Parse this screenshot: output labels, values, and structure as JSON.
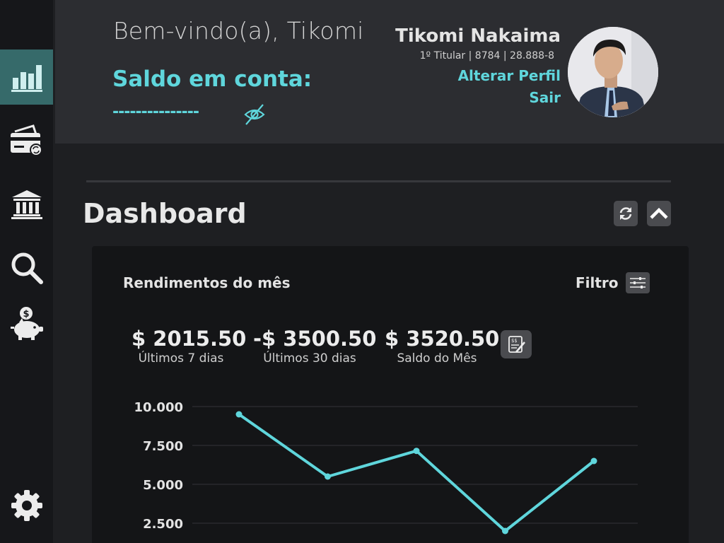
{
  "header": {
    "welcome": "Bem-vindo(a), Tikomi",
    "balance_label": "Saldo em conta:",
    "balance_hidden": "---------------",
    "balance_toggle_icon": "eye-slash-icon",
    "user": {
      "name": "Tikomi Nakaima",
      "info": "1º Titular | 8784 | 28.888-8",
      "edit_profile": "Alterar Perfil",
      "logout": "Sair"
    }
  },
  "sidebar": {
    "items": [
      {
        "icon": "bar-chart-icon",
        "active": true
      },
      {
        "icon": "card-sync-icon",
        "active": false
      },
      {
        "icon": "bank-icon",
        "active": false
      },
      {
        "icon": "search-icon",
        "active": false
      },
      {
        "icon": "piggy-bank-icon",
        "active": false
      },
      {
        "icon": "gear-icon",
        "active": false
      }
    ]
  },
  "dashboard": {
    "title": "Dashboard",
    "refresh_icon": "refresh-icon",
    "collapse_icon": "chevron-up-icon",
    "card": {
      "title": "Rendimentos do mês",
      "filter_label": "Filtro",
      "filter_icon": "sliders-icon",
      "report_icon": "report-icon",
      "stats": [
        {
          "value": "$ 2015.50",
          "label": "Últimos 7 dias"
        },
        {
          "value": "-$ 3500.50",
          "label": "Últimos 30 dias"
        },
        {
          "value": "$ 3520.50",
          "label": "Saldo do Mês"
        }
      ]
    }
  },
  "colors": {
    "accent": "#5fd6dc",
    "active_nav": "#366a6a",
    "background": "#1e1f22",
    "header": "#2c2d31",
    "card": "#141517"
  },
  "chart_data": {
    "type": "line",
    "y_ticks": [
      "10.000",
      "7.500",
      "5.000",
      "2.500"
    ],
    "y_tick_values": [
      10000,
      7500,
      5000,
      2500
    ],
    "values": [
      9500,
      5500,
      7150,
      2000,
      6500
    ],
    "grid": true,
    "color": "#5fd6dc"
  }
}
